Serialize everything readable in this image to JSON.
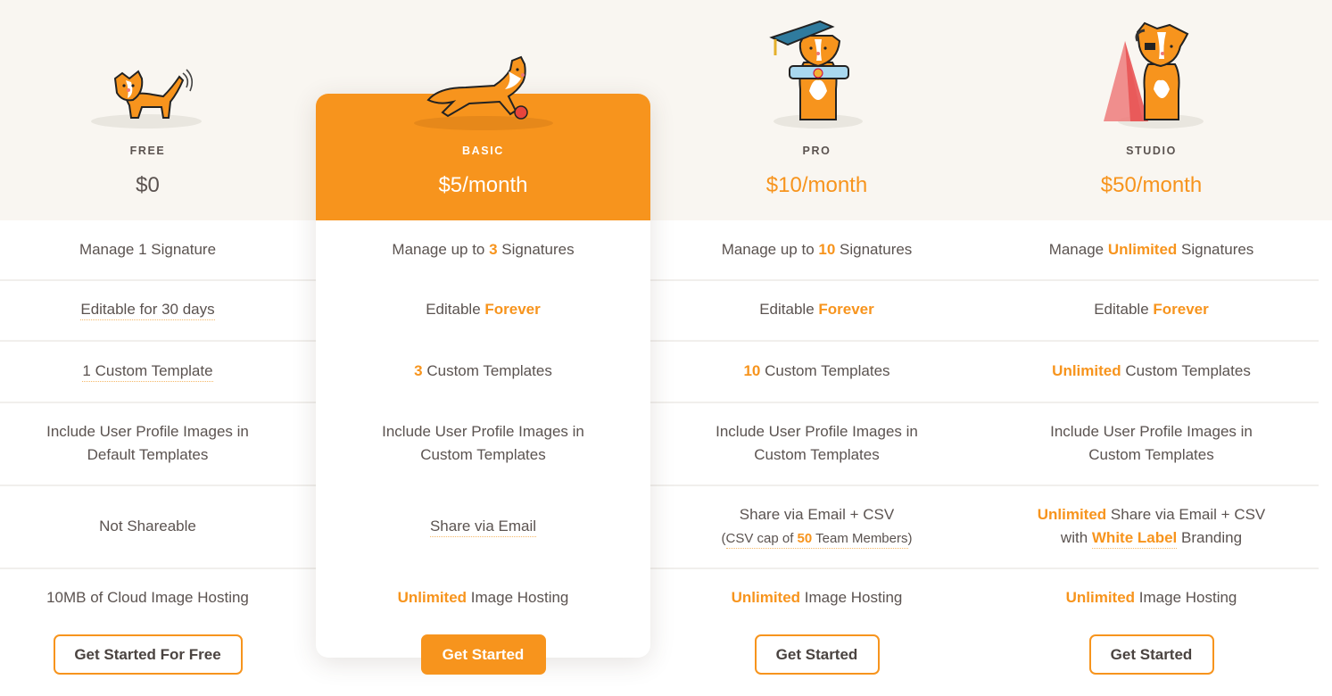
{
  "colors": {
    "accent": "#f7941d",
    "header_bg": "#f9f6f1",
    "text": "#5b5350"
  },
  "plans": [
    {
      "name": "FREE",
      "price": "$0",
      "mascot": "dog-wagging-tail-icon",
      "features": {
        "signatures": {
          "pre": "Manage 1 Signature",
          "hl": "",
          "post": ""
        },
        "editable": {
          "text": "Editable for 30 days"
        },
        "templates": {
          "text": "1 Custom Template"
        },
        "profile_line1": "Include User Profile Images in",
        "profile_line2": "Default Templates",
        "share": "Not Shareable",
        "hosting": {
          "hl": "",
          "post": "10MB of Cloud Image Hosting"
        }
      },
      "cta": "Get Started For Free"
    },
    {
      "name": "BASIC",
      "price": "$5/month",
      "mascot": "dog-running-with-ball-icon",
      "features": {
        "signatures": {
          "pre": "Manage up to ",
          "hl": "3",
          "post": " Signatures"
        },
        "editable": {
          "pre": "Editable ",
          "hl": "Forever"
        },
        "templates": {
          "hl": "3",
          "post": " Custom Templates"
        },
        "profile_line1": "Include User Profile Images in",
        "profile_line2": "Custom Templates",
        "share": "Share via Email",
        "hosting": {
          "hl": "Unlimited",
          "post": " Image Hosting"
        }
      },
      "cta": "Get Started"
    },
    {
      "name": "PRO",
      "price": "$10/month",
      "mascot": "dog-graduate-cap-diploma-icon",
      "features": {
        "signatures": {
          "pre": "Manage up to ",
          "hl": "10",
          "post": " Signatures"
        },
        "editable": {
          "pre": "Editable ",
          "hl": "Forever"
        },
        "templates": {
          "hl": "10",
          "post": " Custom Templates"
        },
        "profile_line1": "Include User Profile Images in",
        "profile_line2": "Custom Templates",
        "share_line1": "Share via Email + CSV",
        "share_line2": {
          "pre": "CSV cap of ",
          "hl": "50",
          "post": " Team Members"
        },
        "hosting": {
          "hl": "Unlimited",
          "post": " Image Hosting"
        }
      },
      "cta": "Get Started"
    },
    {
      "name": "STUDIO",
      "price": "$50/month",
      "mascot": "dog-headset-spotlight-icon",
      "features": {
        "signatures": {
          "pre": "Manage ",
          "hl": "Unlimited",
          "post": " Signatures"
        },
        "editable": {
          "pre": "Editable ",
          "hl": "Forever"
        },
        "templates": {
          "hl": "Unlimited",
          "post": " Custom Templates"
        },
        "profile_line1": "Include User Profile Images in",
        "profile_line2": "Custom Templates",
        "share_line1": {
          "hl": "Unlimited",
          "post": " Share via Email + CSV"
        },
        "share_line2": {
          "pre": "with ",
          "hl": "White Label",
          "post": " Branding"
        },
        "hosting": {
          "hl": "Unlimited",
          "post": " Image Hosting"
        }
      },
      "cta": "Get Started"
    }
  ]
}
